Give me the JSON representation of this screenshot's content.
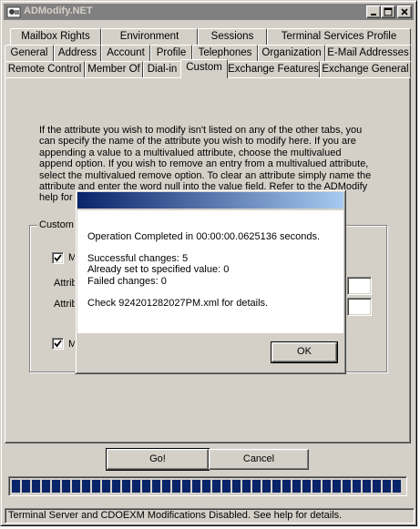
{
  "window": {
    "title": "ADModify.NET"
  },
  "tabs": {
    "row1": [
      {
        "label": "Mailbox Rights"
      },
      {
        "label": "Environment"
      },
      {
        "label": "Sessions"
      },
      {
        "label": "Terminal Services Profile"
      }
    ],
    "row2": [
      {
        "label": "General"
      },
      {
        "label": "Address"
      },
      {
        "label": "Account"
      },
      {
        "label": "Profile"
      },
      {
        "label": "Telephones"
      },
      {
        "label": "Organization"
      },
      {
        "label": "E-Mail Addresses"
      }
    ],
    "row3": [
      {
        "label": "Remote Control"
      },
      {
        "label": "Member Of"
      },
      {
        "label": "Dial-in"
      },
      {
        "label": "Custom",
        "active": true
      },
      {
        "label": "Exchange Features"
      },
      {
        "label": "Exchange General"
      }
    ]
  },
  "custom": {
    "help_lines": [
      "If the attribute you wish to modify isn't listed on any of the other tabs, you",
      "can specify the name of the attribute you wish to modify here.  If you are",
      "appending a value to a multivalued attribute, choose the multivalued",
      "append option.  If you wish to remove an entry from a multivalued attribute,",
      "select the multivalued remove option.  To clear an attribute simply name the",
      "attribute and enter the word null into the value field.  Refer to the ADModify",
      "help for"
    ],
    "group_label": "Custom",
    "checkbox1_label": "M",
    "checkbox1_checked": true,
    "attr_label1": "Attrib",
    "attr_label2": "Attrib",
    "checkbox2_label": "M",
    "checkbox2_checked": true
  },
  "buttons": {
    "go": "Go!",
    "cancel": "Cancel"
  },
  "progress": {
    "value_percent": 100
  },
  "status": "Terminal Server and CDOEXM Modifications Disabled.  See help for details.",
  "dialog": {
    "line1": "Operation Completed in 00:00:00.0625136 seconds.",
    "line2": "Successful changes: 5",
    "line3": "Already set to specified value: 0",
    "line4": "Failed changes: 0",
    "line5": "Check 924201282027PM.xml for details.",
    "ok_label": "OK"
  },
  "colors": {
    "inactive_title": "#808080",
    "active_title": "#0a246a",
    "face": "#d4d0c8"
  }
}
